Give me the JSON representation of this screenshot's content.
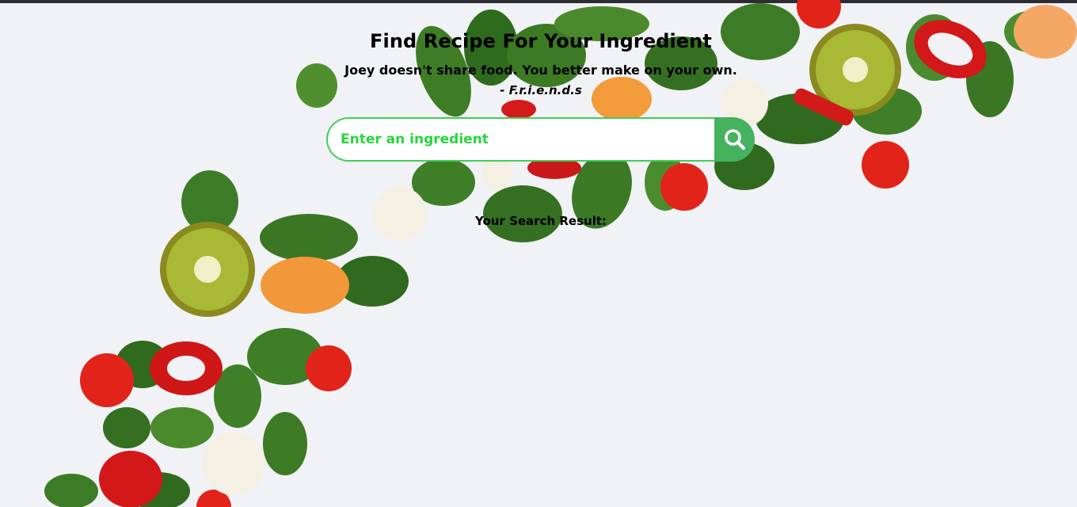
{
  "header": {
    "title": "Find Recipe For Your Ingredient",
    "quote": "Joey doesn't share food. You better make on your own.",
    "attribution": "- F.r.i.e.n.d.s"
  },
  "search": {
    "placeholder": "Enter an ingredient",
    "value": "",
    "button_icon": "search-icon"
  },
  "results": {
    "label": "Your Search Result:",
    "items": []
  },
  "colors": {
    "accent": "#44b25f",
    "input_border": "#3fcf55",
    "placeholder": "#2ad43f"
  }
}
